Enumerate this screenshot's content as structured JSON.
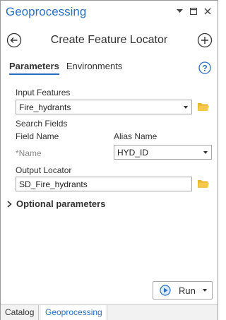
{
  "pane": {
    "title": "Geoprocessing",
    "controls": {
      "menu_icon": "dropdown-arrow",
      "pin_icon": "restore-window",
      "close_icon": "close"
    }
  },
  "tool": {
    "title": "Create Feature Locator",
    "back_icon": "back-arrow-circle",
    "add_icon": "add-circle"
  },
  "tabs": [
    {
      "label": "Parameters",
      "active": true
    },
    {
      "label": "Environments",
      "active": false
    }
  ],
  "help_icon": "help-circle",
  "params": {
    "input_features": {
      "label": "Input Features",
      "value": "Fire_hydrants"
    },
    "search_fields": {
      "label": "Search Fields",
      "field_name_header": "Field Name",
      "alias_name_header": "Alias Name",
      "row": {
        "field": "*Name",
        "alias": "HYD_ID"
      }
    },
    "output_locator": {
      "label": "Output Locator",
      "value": "SD_Fire_hydrants"
    }
  },
  "optional": {
    "label": "Optional parameters"
  },
  "run": {
    "label": "Run"
  },
  "bottom_tabs": [
    {
      "label": "Catalog",
      "active": false
    },
    {
      "label": "Geoprocessing",
      "active": true
    }
  ],
  "colors": {
    "accent": "#2b6fc0",
    "folder": "#e8b730"
  }
}
